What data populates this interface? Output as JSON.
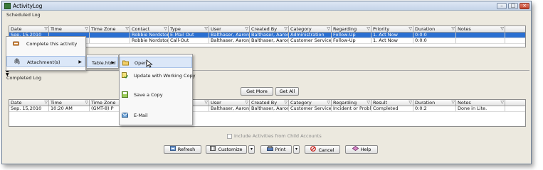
{
  "window": {
    "title": "ActivityLog"
  },
  "scheduled": {
    "label": "Scheduled Log",
    "columns": [
      "Date",
      "Time",
      "Time Zone",
      "Contact",
      "Type",
      "User",
      "Created By",
      "Category",
      "Regarding",
      "Priority",
      "Duration",
      "Notes"
    ],
    "rows": [
      {
        "selected": true,
        "cells": [
          "Sep. 15,2010",
          "",
          "",
          "Robbie Nordstome",
          "E-Mail Out",
          "Balthaser, Aaron",
          "Balthaser, Aaron",
          "Administration",
          "Follow-Up",
          "1. Act Now",
          "0:0:0",
          ""
        ]
      },
      {
        "selected": false,
        "cells": [
          "",
          "",
          "",
          "Robbie Nordstome",
          "Call-Out",
          "Balthaser, Aaron",
          "Balthaser, Aaron",
          "Customer Service",
          "Follow-Up",
          "1. Act Now",
          "0:0:0",
          ""
        ]
      }
    ]
  },
  "completed": {
    "label": "Completed Log",
    "get_more": "Get More",
    "get_all": "Get All",
    "columns": [
      "Date",
      "Time",
      "Time Zone",
      "Contact",
      "Type",
      "User",
      "Created By",
      "Category",
      "Regarding",
      "Result",
      "Duration",
      "Notes"
    ],
    "rows": [
      {
        "cells": [
          "Sep. 15,2010",
          "10:20 AM",
          "(GMT-8) P",
          "",
          "Out",
          "Balthaser, Aaron",
          "Balthaser, Aaron",
          "Customer Service",
          "Incident or Problem",
          "Completed",
          "0:0:2",
          "Done in Lite."
        ]
      }
    ]
  },
  "context_menu": {
    "complete_label": "Complete this activity",
    "attachments_label": "Attachment(s)",
    "file_label": "Table.html",
    "sub_items": [
      "Open",
      "Update with Working Copy",
      "Save a Copy",
      "E-Mail"
    ]
  },
  "include_child": "Include Activities from Child Accounts",
  "footer": {
    "refresh": "Refresh",
    "customize": "Customize",
    "print": "Print",
    "cancel": "Cancel",
    "help": "Help"
  },
  "colors": {
    "selection": "#2a6fd1",
    "menu_highlight": "#dbe7f8",
    "close_button": "#c0432b"
  }
}
